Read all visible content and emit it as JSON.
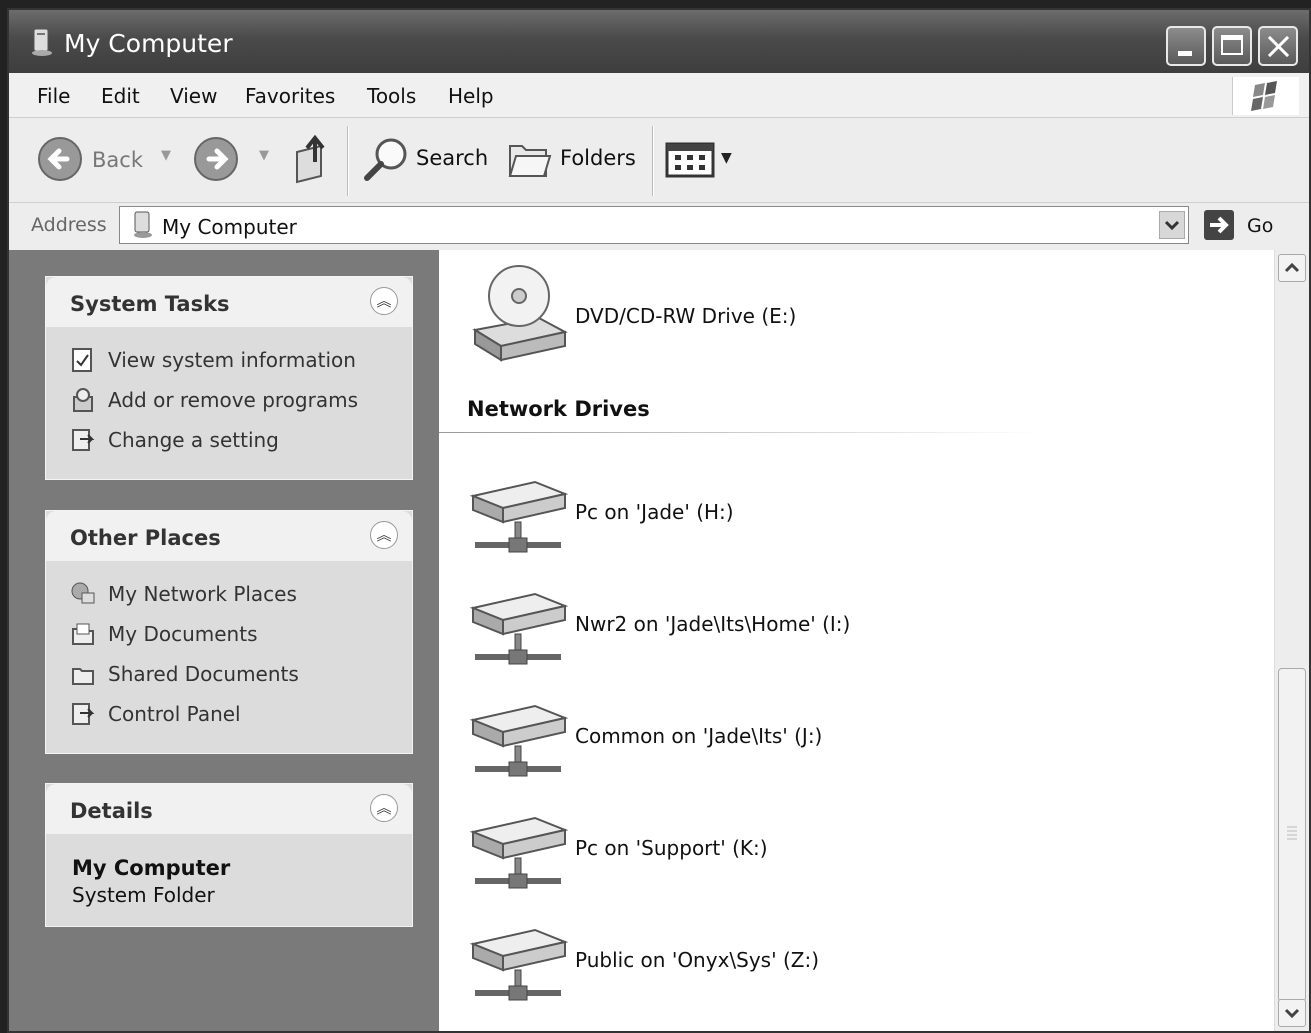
{
  "window": {
    "title": "My Computer"
  },
  "menu": {
    "file": "File",
    "edit": "Edit",
    "view": "View",
    "favorites": "Favorites",
    "tools": "Tools",
    "help": "Help"
  },
  "toolbar": {
    "back": "Back",
    "search": "Search",
    "folders": "Folders"
  },
  "address": {
    "label": "Address",
    "value": "My Computer",
    "go": "Go"
  },
  "system_tasks": {
    "title": "System Tasks",
    "items": [
      "View system information",
      "Add or remove programs",
      "Change a setting"
    ]
  },
  "other_places": {
    "title": "Other Places",
    "items": [
      "My Network Places",
      "My Documents",
      "Shared Documents",
      "Control Panel"
    ]
  },
  "details": {
    "title": "Details",
    "name": "My Computer",
    "type": "System Folder"
  },
  "content": {
    "dvd": "DVD/CD-RW Drive (E:)",
    "network_title": "Network Drives",
    "network_drives": [
      "Pc on 'Jade' (H:)",
      "Nwr2 on 'Jade\\Its\\Home' (I:)",
      "Common on 'Jade\\Its' (J:)",
      "Pc on 'Support' (K:)",
      "Public on 'Onyx\\Sys' (Z:)"
    ]
  }
}
